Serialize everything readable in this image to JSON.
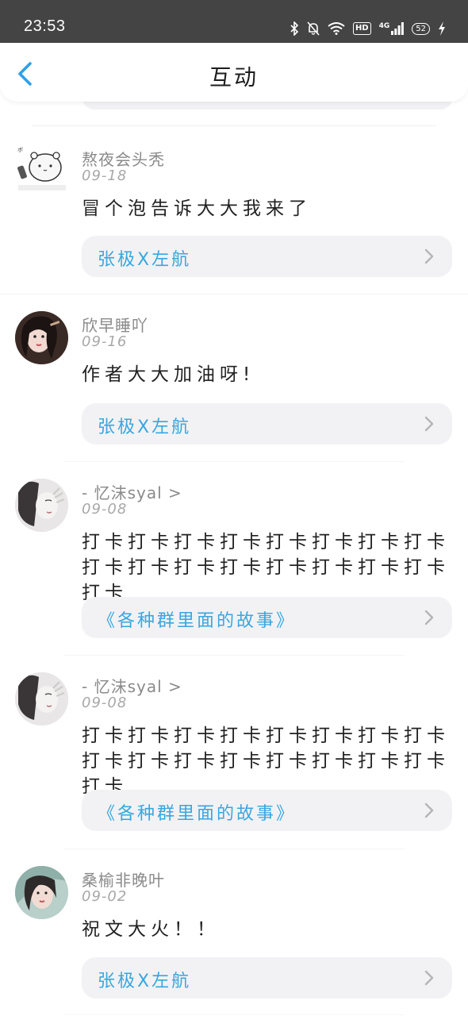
{
  "status_bar": {
    "time": "23:53",
    "icons": [
      "bluetooth-icon",
      "bell-muted-icon",
      "wifi-icon",
      "hd-icon",
      "4g-signal-icon",
      "battery-icon",
      "charging-icon"
    ],
    "hd_label": "HD",
    "network_label": "4G",
    "battery_level": "52"
  },
  "header": {
    "title": "互动",
    "back_icon": "chevron-left-icon",
    "accent_color": "#2f9fe8"
  },
  "colors": {
    "link_text": "#38a6e0",
    "card_bg": "#f2f2f4",
    "name_text": "#8a8a8a"
  },
  "interactions": [
    {
      "user": "熬夜会头秃",
      "date": "09-18",
      "comment": "冒个泡告诉大大我来了",
      "book": "张极X左航",
      "avatar": "hamster-sticker"
    },
    {
      "user": "欣早睡吖",
      "date": "09-16",
      "comment": "作者大大加油呀!",
      "book": "张极X左航",
      "avatar": "girl-portrait"
    },
    {
      "user": "- 忆沫syal >",
      "date": "09-08",
      "comment": "打卡打卡打卡打卡打卡打卡打卡打卡打卡打卡打卡打卡打卡打卡打卡打卡打卡",
      "book": "《各种群里面的故事》",
      "avatar": "bw-portrait"
    },
    {
      "user": "- 忆沫syal >",
      "date": "09-08",
      "comment": "打卡打卡打卡打卡打卡打卡打卡打卡打卡打卡打卡打卡打卡打卡打卡打卡打卡",
      "book": "《各种群里面的故事》",
      "avatar": "bw-portrait"
    },
    {
      "user": "桑榆非晚叶",
      "date": "09-02",
      "comment": "祝文大火！！",
      "book": "张极X左航",
      "avatar": "teal-portrait"
    }
  ]
}
